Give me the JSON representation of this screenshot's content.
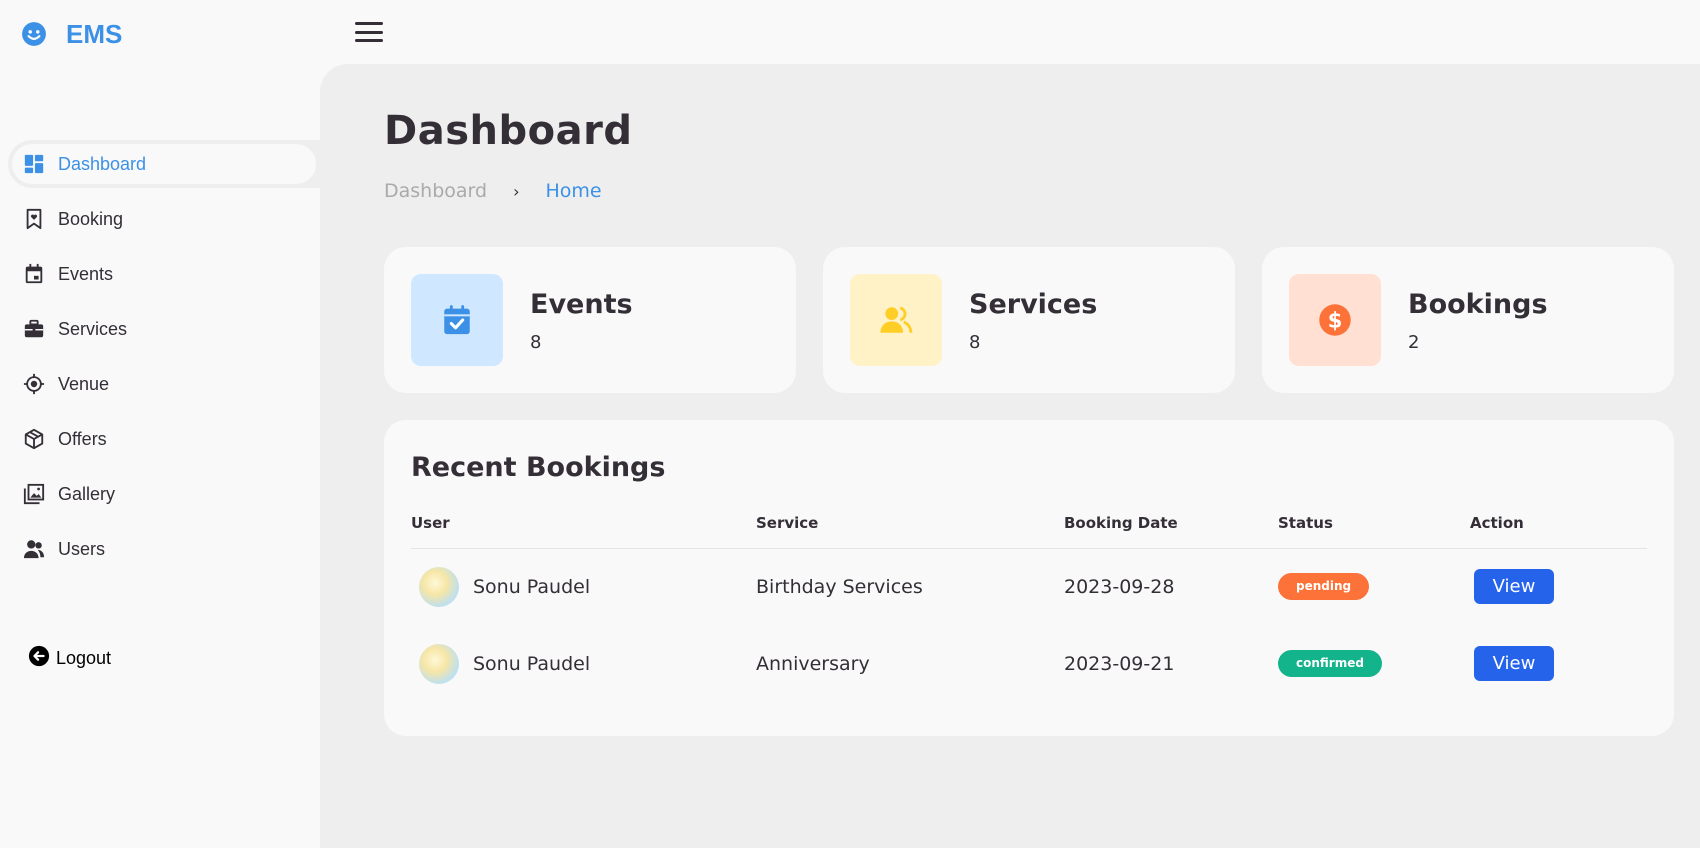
{
  "brand": {
    "name": "EMS"
  },
  "sidebar": {
    "items": [
      {
        "label": "Dashboard",
        "icon": "dashboard-icon",
        "active": true
      },
      {
        "label": "Booking",
        "icon": "bookmark-heart-icon",
        "active": false
      },
      {
        "label": "Events",
        "icon": "calendar-icon",
        "active": false
      },
      {
        "label": "Services",
        "icon": "briefcase-icon",
        "active": false
      },
      {
        "label": "Venue",
        "icon": "target-icon",
        "active": false
      },
      {
        "label": "Offers",
        "icon": "package-icon",
        "active": false
      },
      {
        "label": "Gallery",
        "icon": "gallery-icon",
        "active": false
      },
      {
        "label": "Users",
        "icon": "users-icon",
        "active": false
      }
    ],
    "logout_label": "Logout"
  },
  "main": {
    "title": "Dashboard",
    "breadcrumb": [
      "Dashboard",
      "Home"
    ]
  },
  "stats": [
    {
      "title": "Events",
      "value": "8",
      "icon": "calendar-check-icon",
      "bg": "#cfe8ff",
      "color": "#3c91e6"
    },
    {
      "title": "Services",
      "value": "8",
      "icon": "people-icon",
      "bg": "#fff2c6",
      "color": "#ffce26"
    },
    {
      "title": "Bookings",
      "value": "2",
      "icon": "dollar-circle-icon",
      "bg": "#ffe0d3",
      "color": "#fd7238"
    }
  ],
  "recent_bookings": {
    "title": "Recent Bookings",
    "columns": [
      "User",
      "Service",
      "Booking Date",
      "Status",
      "Action"
    ],
    "rows": [
      {
        "user": "Sonu Paudel",
        "service": "Birthday Services",
        "date": "2023-09-28",
        "status": "pending",
        "status_color": "#fd7238",
        "action": "View"
      },
      {
        "user": "Sonu Paudel",
        "service": "Anniversary",
        "date": "2023-09-21",
        "status": "confirmed",
        "status_color": "#13b38b",
        "action": "View"
      }
    ]
  },
  "colors": {
    "accent": "#3c91e6",
    "button": "#2563eb",
    "dark": "#342e37",
    "light": "#f9f9f9",
    "grey": "#eeeeee"
  }
}
